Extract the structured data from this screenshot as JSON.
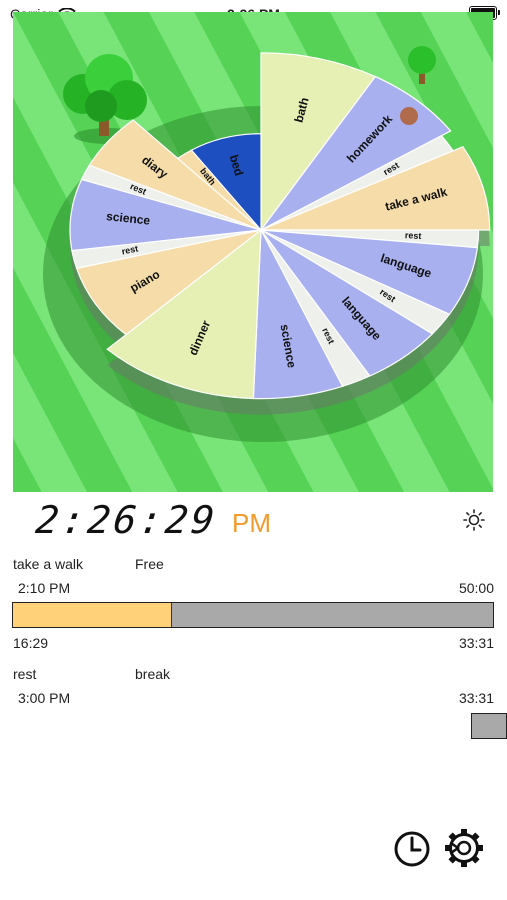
{
  "status_bar": {
    "carrier": "Carrier",
    "time": "2:26 PM"
  },
  "schedule_chart": {
    "slices": [
      {
        "label": "bath",
        "color": "#e6efb4",
        "start": 0,
        "end": 30
      },
      {
        "label": "homework",
        "color": "#a8b0f0",
        "start": 30,
        "end": 56
      },
      {
        "label": "rest",
        "color": "#eef0ec",
        "start": 56,
        "end": 62
      },
      {
        "label": "take a walk",
        "color": "#f5dca8",
        "start": 62,
        "end": 90
      },
      {
        "label": "rest",
        "color": "#eef0ec",
        "start": 90,
        "end": 96
      },
      {
        "label": "language",
        "color": "#a8b0f0",
        "start": 96,
        "end": 120
      },
      {
        "label": "rest",
        "color": "#eef0ec",
        "start": 120,
        "end": 128
      },
      {
        "label": "language",
        "color": "#a8b0f0",
        "start": 128,
        "end": 150
      },
      {
        "label": "rest",
        "color": "#eef0ec",
        "start": 150,
        "end": 158
      },
      {
        "label": "science",
        "color": "#a8b0f0",
        "start": 158,
        "end": 182
      },
      {
        "label": "dinner",
        "color": "#e6efb4",
        "start": 182,
        "end": 225
      },
      {
        "label": "piano",
        "color": "#f5dca8",
        "start": 225,
        "end": 255
      },
      {
        "label": "rest",
        "color": "#eef0ec",
        "start": 255,
        "end": 262
      },
      {
        "label": "science",
        "color": "#a8b0f0",
        "start": 262,
        "end": 290
      },
      {
        "label": "rest",
        "color": "#eef0ec",
        "start": 290,
        "end": 296
      },
      {
        "label": "diary",
        "color": "#f5dca8",
        "start": 296,
        "end": 318
      },
      {
        "label": "bath",
        "color": "#f5dca8",
        "start": 318,
        "end": 326
      },
      {
        "label": "bed",
        "color": "#1e4fc0",
        "start": 326,
        "end": 360
      }
    ]
  },
  "clock": {
    "time": "2:26:29",
    "ampm": "PM"
  },
  "current_task": {
    "name": "take a walk",
    "category": "Free",
    "start_time": "2:10 PM",
    "duration": "50:00",
    "elapsed": "16:29",
    "remaining": "33:31",
    "progress": 0.33
  },
  "next_task": {
    "name": "rest",
    "category": "break",
    "start_time": "3:00 PM",
    "countdown": "33:31"
  },
  "icons": {
    "brightness": "sun-icon",
    "history": "clock-icon",
    "settings": "gear-icon"
  }
}
